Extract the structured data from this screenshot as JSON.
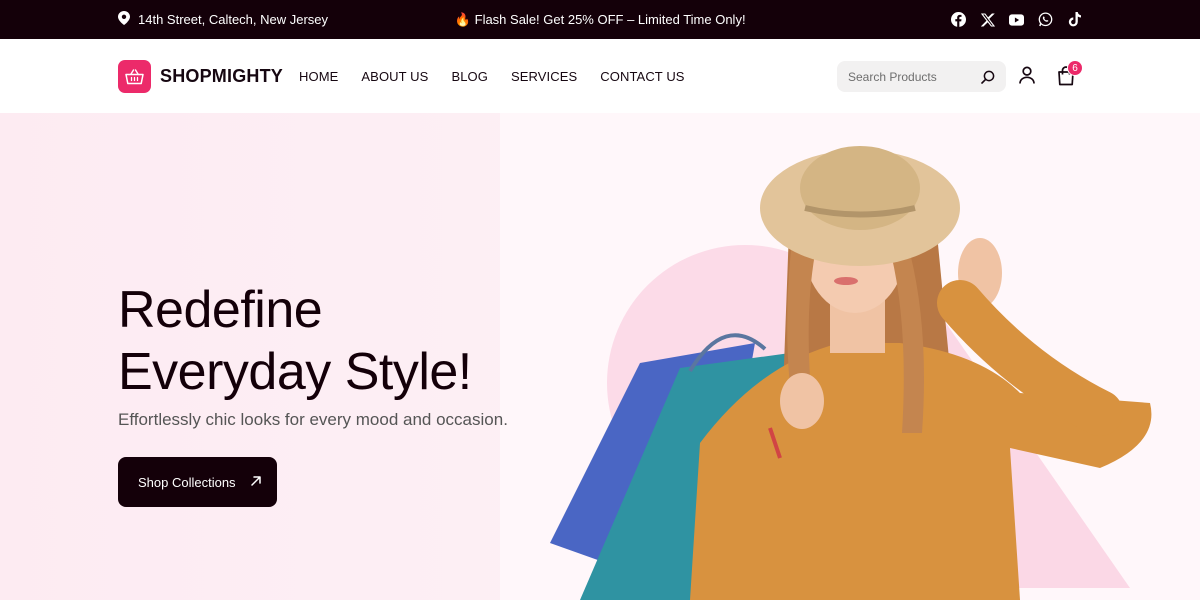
{
  "topbar": {
    "location": "14th Street, Caltech, New Jersey",
    "promo_emoji": "🔥",
    "promo": "Flash Sale! Get 25% OFF – Limited Time Only!",
    "socials": [
      "facebook-icon",
      "x-icon",
      "youtube-icon",
      "whatsapp-icon",
      "tiktok-icon"
    ]
  },
  "header": {
    "brand": "SHOPMIGHTY",
    "nav": [
      "HOME",
      "ABOUT US",
      "BLOG",
      "SERVICES",
      "CONTACT US"
    ],
    "search_placeholder": "Search Products",
    "cart_count": "6"
  },
  "hero": {
    "title_line1": "Redefine",
    "title_line2": "Everyday Style!",
    "subtitle": "Effortlessly chic looks for every mood and occasion.",
    "cta_label": "Shop Collections"
  },
  "colors": {
    "brand": "#ec2a6a",
    "dark": "#140009",
    "hero_bg": "#fdeef4"
  }
}
